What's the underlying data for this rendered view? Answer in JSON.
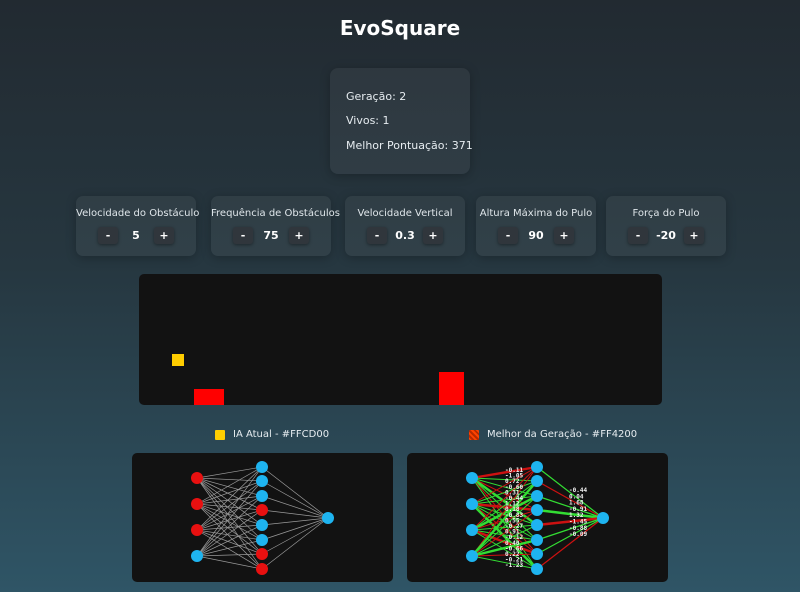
{
  "app": {
    "title": "EvoSquare"
  },
  "stats": {
    "generation": "Geração: 2",
    "alive": "Vivos: 1",
    "best_score": "Melhor Pontuação: 371"
  },
  "controls": [
    {
      "label": "Velocidade do Obstáculo",
      "value": "5",
      "minus": "-",
      "plus": "+"
    },
    {
      "label": "Frequência de Obstáculos",
      "value": "75",
      "minus": "-",
      "plus": "+"
    },
    {
      "label": "Velocidade Vertical",
      "value": "0.3",
      "minus": "-",
      "plus": "+"
    },
    {
      "label": "Altura Máxima do Pulo",
      "value": "90",
      "minus": "-",
      "plus": "+"
    },
    {
      "label": "Força do Pulo",
      "value": "-20",
      "minus": "-",
      "plus": "+"
    }
  ],
  "legend": {
    "current_ai": "IA Atual - #FFCD00",
    "current_ai_color": "#FFCD00",
    "best_gen": "Melhor da Geração - #FF4200",
    "best_gen_color": "#FF4200"
  },
  "colors": {
    "player": "#FFCD00",
    "obstacle": "#FF0000",
    "node_active": "#E81010",
    "node_inactive": "#1EB4F0",
    "weight_positive": "#33DD33",
    "weight_negative": "#CC1111"
  },
  "network_weights": {
    "hidden_top_labels": [
      "-0.11",
      "-1.05",
      "0.72",
      "-0.60",
      "0.31",
      "-0.44",
      "1.12",
      "0.18",
      "-0.83",
      "0.55",
      "-0.27",
      "0.91",
      "-0.12",
      "0.40",
      "-0.66",
      "0.22",
      "-0.21",
      "-1.23"
    ],
    "output_labels": [
      "-0.44",
      "0.04",
      "1.68",
      "-0.91",
      "1.32",
      "-1.45",
      "-0.88",
      "-0.09"
    ]
  }
}
